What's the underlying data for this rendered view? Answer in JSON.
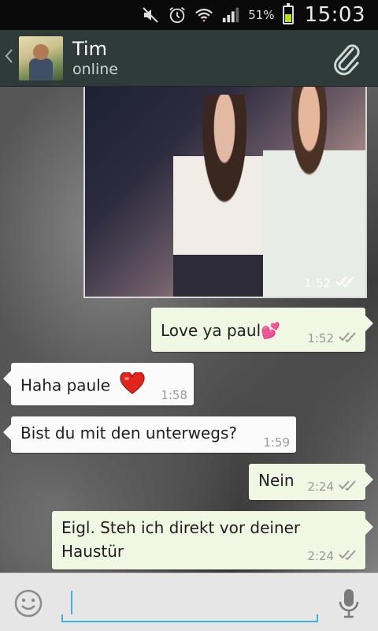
{
  "status_bar": {
    "battery_percent": "51%",
    "battery_level": 0.51,
    "clock": "15:03",
    "icons": [
      "mute-icon",
      "alarm-icon",
      "wifi-icon",
      "signal-icon",
      "battery-icon"
    ]
  },
  "header": {
    "contact_name": "Tim",
    "contact_status": "online",
    "icons": [
      "back-chevron-icon",
      "paperclip-icon"
    ]
  },
  "messages": [
    {
      "type": "image",
      "direction": "out",
      "time": "1:52",
      "status_icon": "double-check-icon"
    },
    {
      "type": "text",
      "direction": "out",
      "text": "Love ya paul",
      "emoji": "💕",
      "time": "1:52",
      "status_icon": "double-check-icon"
    },
    {
      "type": "text",
      "direction": "in",
      "text": "Haha paule",
      "emoji": "❤️",
      "time": "1:58"
    },
    {
      "type": "text",
      "direction": "in",
      "text": "Bist du mit den unterwegs?",
      "time": "1:59"
    },
    {
      "type": "text",
      "direction": "out",
      "text": "Nein",
      "time": "2:24",
      "status_icon": "double-check-icon"
    },
    {
      "type": "text",
      "direction": "out",
      "text_line1": "Eigl. Steh ich direkt vor deiner",
      "text_line2": "Haustür",
      "time": "2:24",
      "status_icon": "double-check-icon"
    }
  ],
  "input_bar": {
    "value": "",
    "icons": [
      "smiley-icon",
      "microphone-icon"
    ]
  },
  "colors": {
    "header_bg": "#2f3b38",
    "outgoing_bubble": "#f0f8e4",
    "incoming_bubble": "#fbfbfb",
    "input_accent": "#3fb3d8",
    "battery_green": "#b6e11a"
  }
}
